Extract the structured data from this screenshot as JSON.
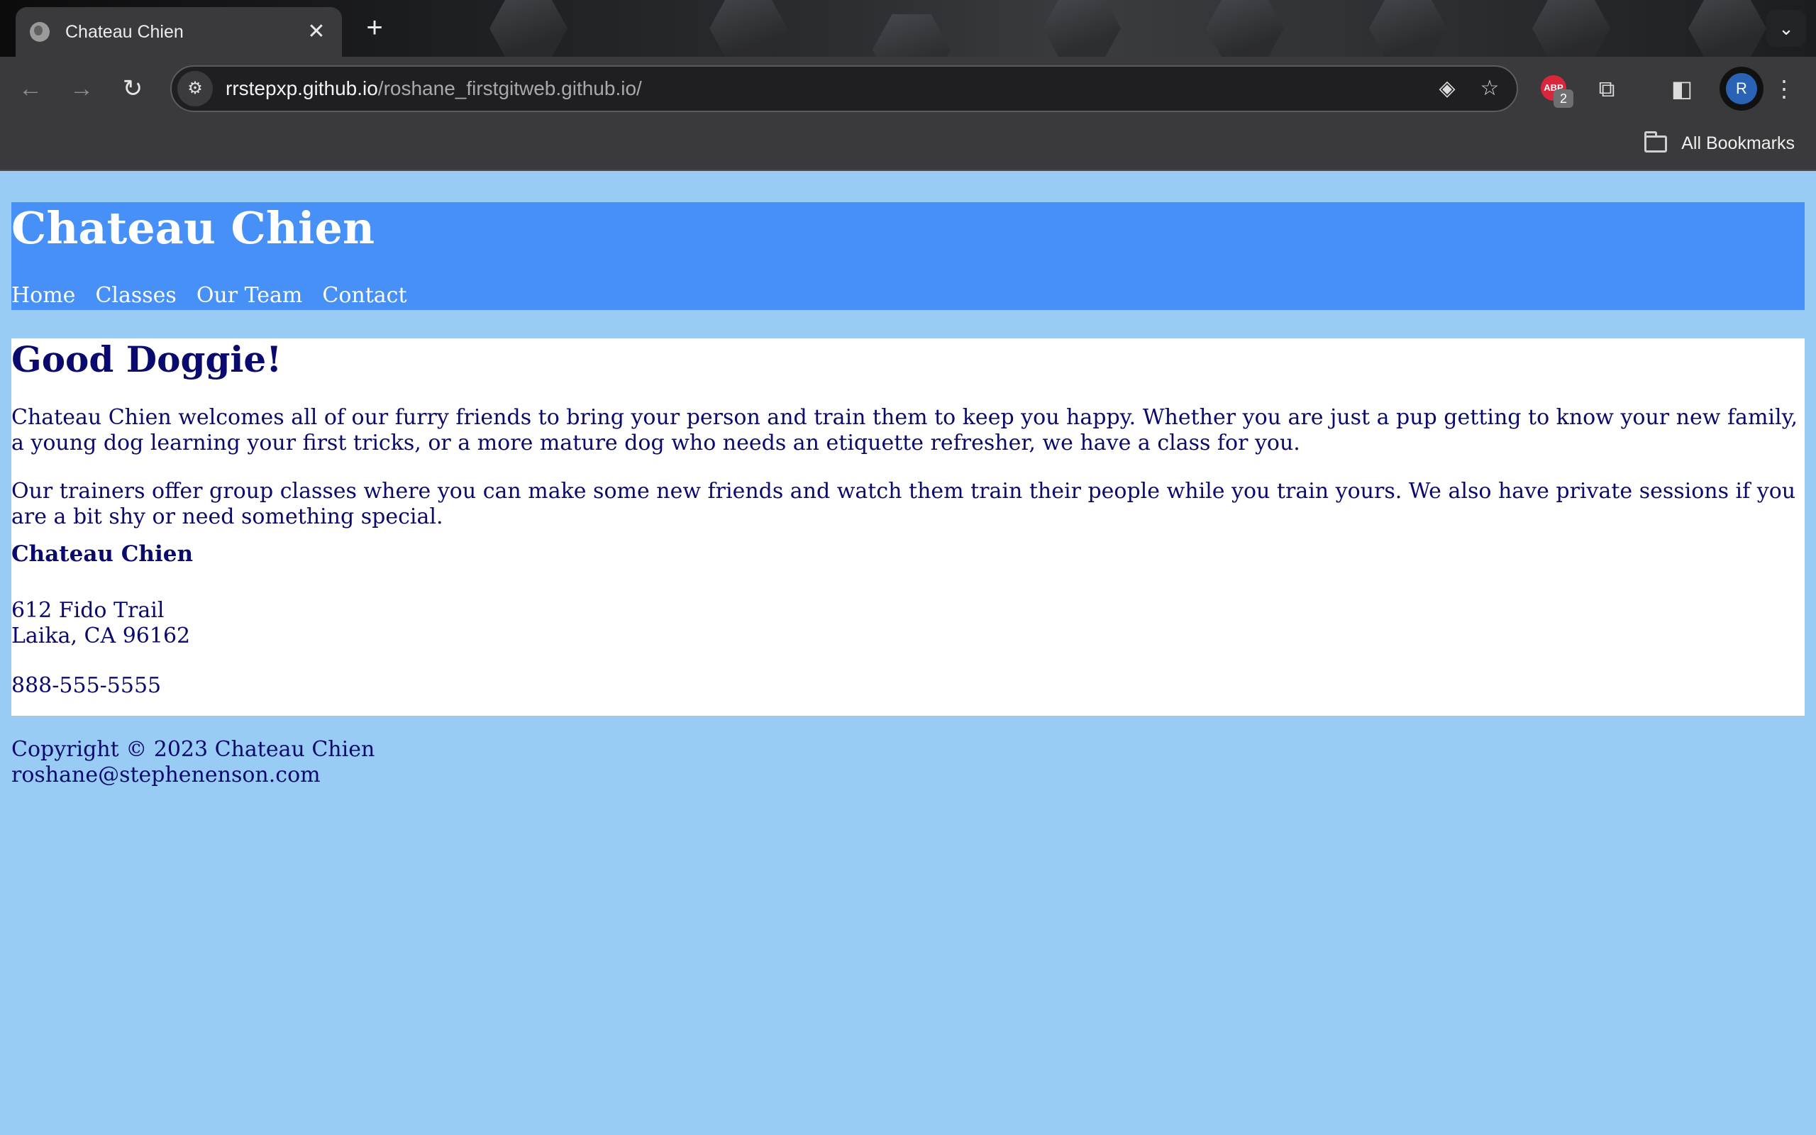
{
  "browser": {
    "tab_title": "Chateau Chien",
    "tab_close": "✕",
    "new_tab": "+",
    "tab_search": "⌄",
    "back": "←",
    "forward": "→",
    "reload": "↻",
    "url_host": "rrstepxp.github.io",
    "url_path": "/roshane_firstgitweb.github.io/",
    "extension_badge_label": "ABP",
    "extension_badge_count": "2",
    "profile_initial": "R",
    "bookmarks_label": "All Bookmarks",
    "icons": {
      "site_info": "tune-icon",
      "lens": "lens-icon",
      "star": "star-icon",
      "extensions": "puzzle-icon",
      "sidepanel": "side-panel-icon",
      "menu": "kebab-menu-icon"
    }
  },
  "site": {
    "title": "Chateau Chien",
    "nav": [
      "Home",
      "Classes",
      "Our Team",
      "Contact"
    ],
    "heading": "Good Doggie!",
    "paragraphs": [
      "Chateau Chien welcomes all of our furry friends to bring your person and train them to keep you happy. Whether you are just a pup getting to know your new family, a young dog learning your first tricks, or a more mature dog who needs an etiquette refresher, we have a class for you.",
      "Our trainers offer group classes where you can make some new friends and watch them train their people while you train yours. We also have private sessions if you are a bit shy or need something special."
    ],
    "business_name": "Chateau Chien",
    "address_line1": "612 Fido Trail",
    "address_line2": "Laika, CA 96162",
    "phone": "888-555-5555",
    "footer_copyright": "Copyright © 2023 Chateau Chien",
    "footer_email": "roshane@stephenenson.com"
  },
  "colors": {
    "page_bg": "#99CCF5",
    "header_bg": "#4790F7",
    "text": "#0A0A6E",
    "content_bg": "#FFFFFF"
  }
}
